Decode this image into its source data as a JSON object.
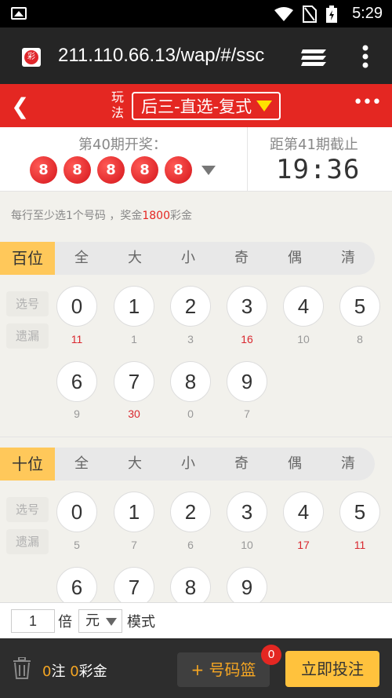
{
  "status_bar": {
    "time": "5:29"
  },
  "browser": {
    "url": "211.110.66.13/wap/#/ssc",
    "favicon_text": "彩"
  },
  "appbar": {
    "play_label_1": "玩",
    "play_label_2": "法",
    "play_mode": "后三-直选-复式",
    "more": "•••"
  },
  "draw": {
    "last_label": "第40期开奖：",
    "balls": [
      "8",
      "8",
      "8",
      "8",
      "8"
    ],
    "next_label": "距第41期截止",
    "countdown": "19:36"
  },
  "hint": {
    "prefix": "每行至少选1个号码 ，奖金",
    "amount": "1800",
    "suffix": "彩金"
  },
  "filters": [
    "全",
    "大",
    "小",
    "奇",
    "偶",
    "清"
  ],
  "side_tags": {
    "select": "选号",
    "missing": "遗漏"
  },
  "sections": [
    {
      "label": "百位",
      "numbers": [
        "0",
        "1",
        "2",
        "3",
        "4",
        "5",
        "6",
        "7",
        "8",
        "9"
      ],
      "missing": [
        "11",
        "1",
        "3",
        "16",
        "10",
        "8",
        "9",
        "30",
        "0",
        "7"
      ]
    },
    {
      "label": "十位",
      "numbers": [
        "0",
        "1",
        "2",
        "3",
        "4",
        "5",
        "6",
        "7",
        "8",
        "9"
      ],
      "missing": [
        "5",
        "7",
        "6",
        "10",
        "17",
        "11"
      ]
    }
  ],
  "multiplier": {
    "value": "1",
    "unit_label": "倍",
    "currency": "元",
    "mode_label": "模式"
  },
  "bottom": {
    "count": "0",
    "count_label": "注",
    "amount": "0",
    "amount_label": "彩金",
    "basket_label": "+ 号码篮",
    "basket_badge": "0",
    "submit_label": "立即投注"
  },
  "colors": {
    "brand_red": "#e42722",
    "accent_yellow": "#ffc23d",
    "hot_missing": "#d9282f"
  }
}
